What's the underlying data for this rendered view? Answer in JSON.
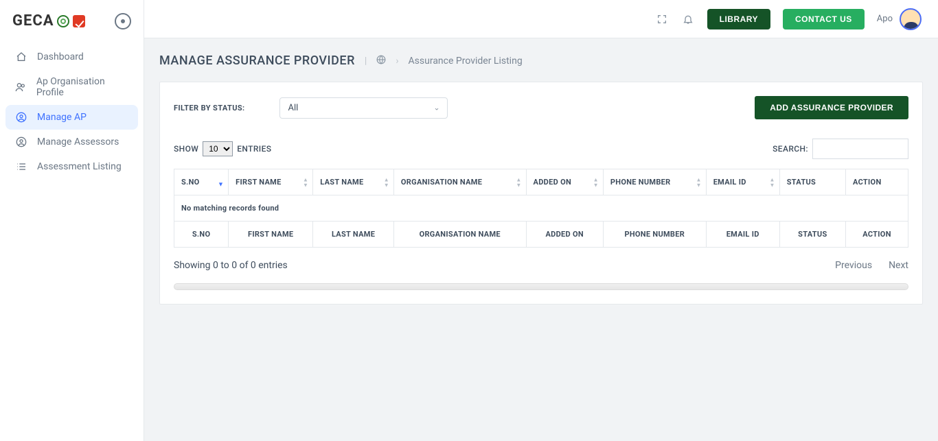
{
  "brand": {
    "name": "GECA"
  },
  "sidebar": {
    "items": [
      {
        "label": "Dashboard",
        "selected": false
      },
      {
        "label": "Ap Organisation Profile",
        "selected": false
      },
      {
        "label": "Manage AP",
        "selected": true
      },
      {
        "label": "Manage Assessors",
        "selected": false
      },
      {
        "label": "Assessment Listing",
        "selected": false
      }
    ]
  },
  "header": {
    "library": "LIBRARY",
    "contact": "CONTACT US",
    "user_name": "Apo"
  },
  "page": {
    "title": "MANAGE ASSURANCE PROVIDER",
    "breadcrumb": "Assurance Provider Listing"
  },
  "filter": {
    "label": "FILTER BY STATUS:",
    "value": "All",
    "add_button": "ADD ASSURANCE PROVIDER"
  },
  "table": {
    "show_prefix": "SHOW",
    "show_suffix": "ENTRIES",
    "show_value": "10",
    "search_label": "SEARCH:",
    "columns": {
      "sno": "S.NO",
      "first": "FIRST NAME",
      "last": "LAST NAME",
      "org": "ORGANISATION NAME",
      "added": "ADDED ON",
      "phone": "PHONE NUMBER",
      "email": "EMAIL ID",
      "status": "STATUS",
      "action": "ACTION"
    },
    "empty": "No matching records found",
    "info": "Showing 0 to 0 of 0 entries",
    "prev": "Previous",
    "next": "Next"
  }
}
